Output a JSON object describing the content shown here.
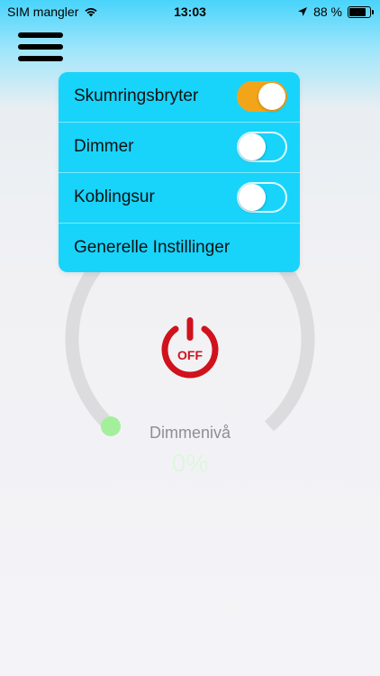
{
  "status_bar": {
    "carrier": "SIM mangler",
    "time": "13:03",
    "battery": "88 %",
    "battery_level": 0.88
  },
  "menu": {
    "items": [
      {
        "label": "Skumringsbryter",
        "toggle": true,
        "on": true
      },
      {
        "label": "Dimmer",
        "toggle": true,
        "on": false
      },
      {
        "label": "Koblingsur",
        "toggle": true,
        "on": false
      },
      {
        "label": "Generelle Instillinger",
        "toggle": false
      }
    ]
  },
  "dial": {
    "power_text": "OFF",
    "label": "Dimmenivå",
    "value": "0%",
    "level": 0
  },
  "colors": {
    "accent_menu": "#18d4fb",
    "toggle_on": "#f3a51a",
    "power_red": "#d0121c",
    "knob_green": "#a4ef9c"
  }
}
